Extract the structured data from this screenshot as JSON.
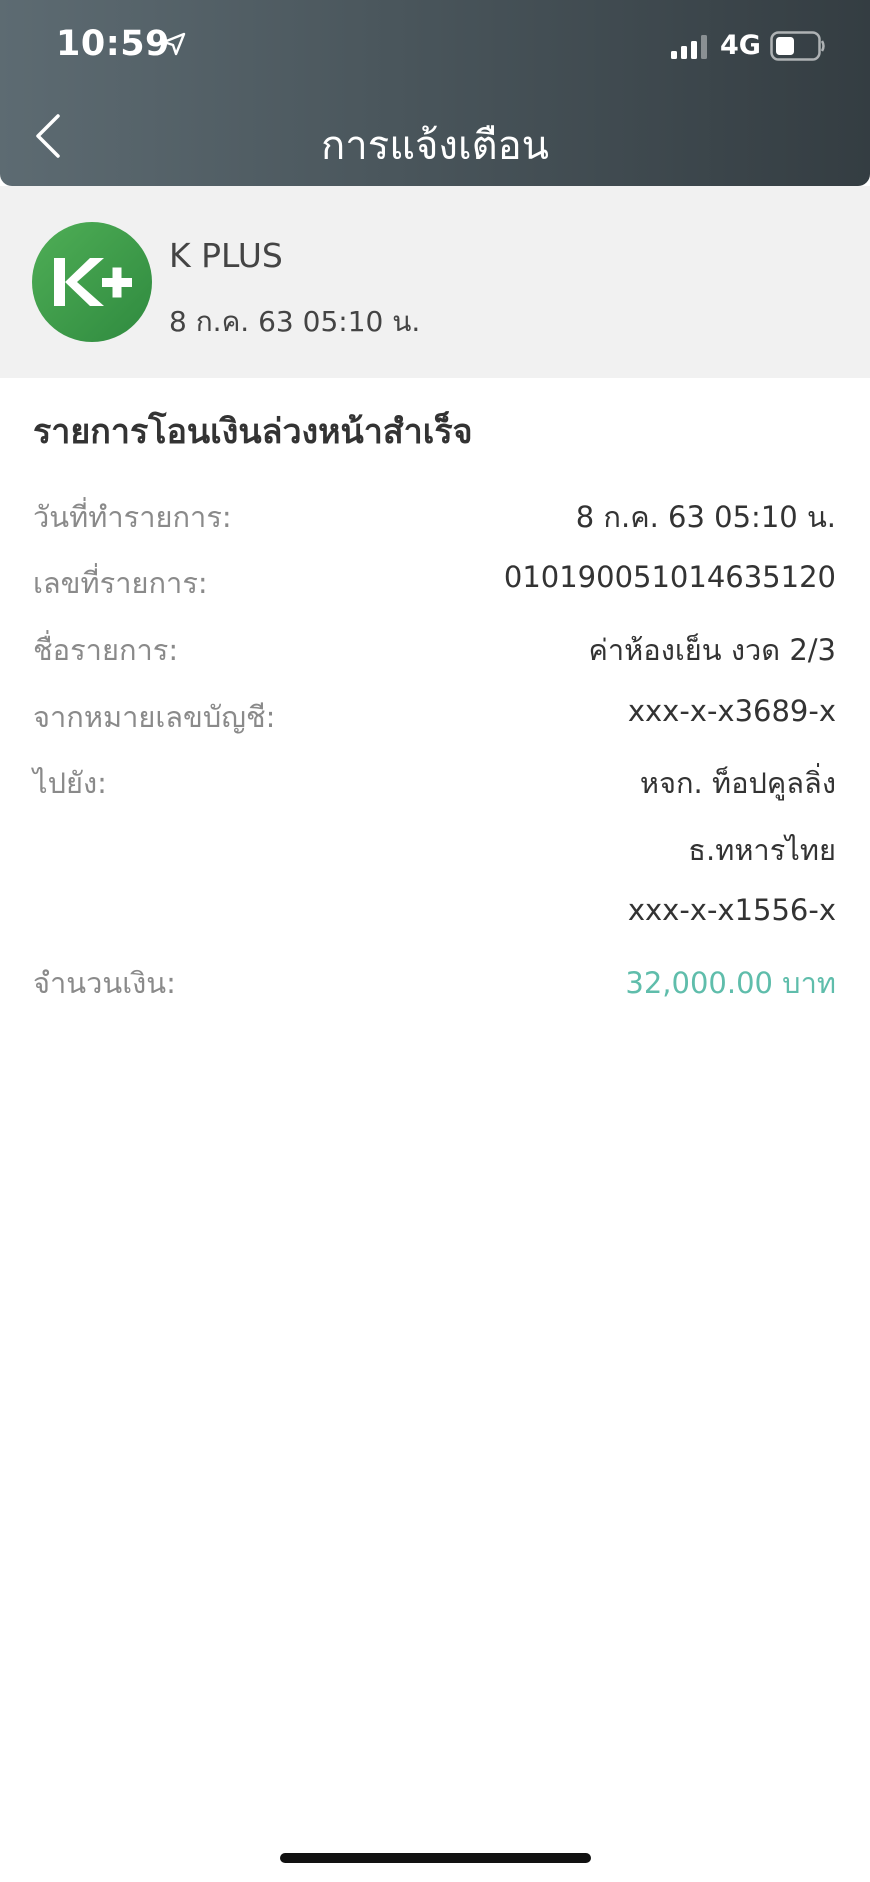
{
  "status_bar": {
    "time": "10:59",
    "network": "4G",
    "icons": [
      "location-arrow-icon",
      "cellular-signal-icon",
      "battery-icon"
    ]
  },
  "nav": {
    "title": "การแจ้งเตือน",
    "back_icon": "chevron-left-icon"
  },
  "sender": {
    "logo_text": "K+",
    "name": "K PLUS",
    "timestamp": "8 ก.ค. 63  05:10 น."
  },
  "message": {
    "title": "รายการโอนเงินล่วงหน้าสำเร็จ",
    "rows": [
      {
        "label": "วันที่ทำรายการ:",
        "value": "8 ก.ค. 63 05:10 น."
      },
      {
        "label": "เลขที่รายการ:",
        "value": "010190051014635120"
      },
      {
        "label": "ชื่อรายการ:",
        "value": "ค่าห้องเย็น งวด 2/3"
      },
      {
        "label": "จากหมายเลขบัญชี:",
        "value": "xxx-x-x3689-x"
      },
      {
        "label": "ไปยัง:",
        "value": "หจก. ท็อปคูลลิ่ง"
      },
      {
        "label": "",
        "value": "ธ.ทหารไทย"
      },
      {
        "label": "",
        "value": "xxx-x-x1556-x"
      },
      {
        "label": "จำนวนเงิน:",
        "value": "32,000.00 บาท"
      }
    ]
  },
  "colors": {
    "header_bg_start": "#5d6b72",
    "header_bg_end": "#343d42",
    "logo_green": "#3f9c4a",
    "amount_teal": "#5fbdab",
    "label_gray": "#8a8a8a",
    "sender_bg": "#f1f1f1"
  }
}
